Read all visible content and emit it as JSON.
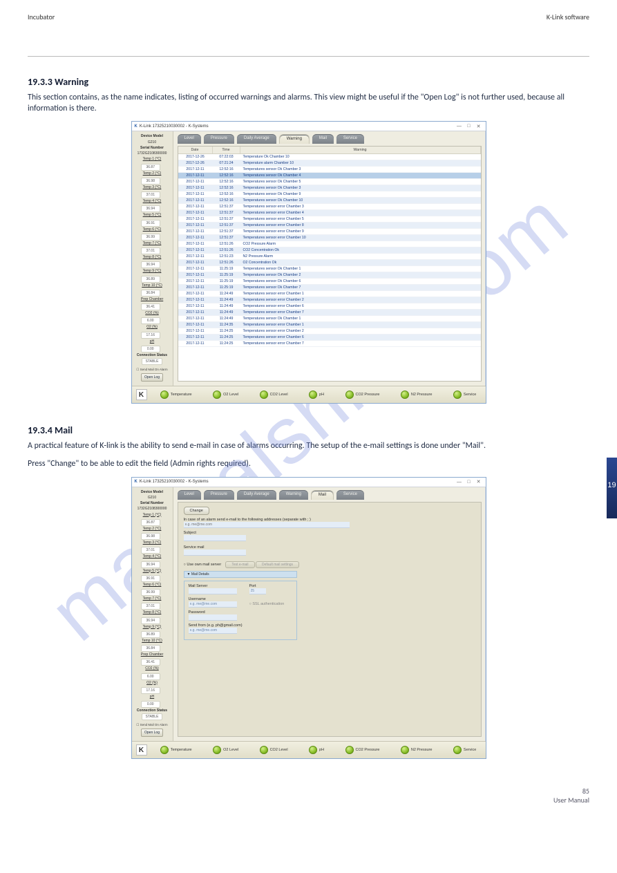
{
  "header": {
    "left": "Incubator",
    "right": "K-Link software"
  },
  "section1_title": "19.3.3 Warning",
  "section1_body": "This section contains, as the name indicates, listing of occurred warnings and alarms. This view might be useful if the \"Open Log\" is not further used, because all information is there.",
  "section2_title": "19.3.4 Mail",
  "section2_body_1": "A practical feature of K-link is the ability to send e-mail in case of alarms occurring. The setup of the e-mail settings is done under \"Mail\".",
  "section2_body_2": "Press \"Change\" to be able to edit the field (Admin rights required).",
  "watermark": "manualshive.com",
  "win1": {
    "title": "K-Link 17325210030002 - K-Systems",
    "tabs": [
      "Level",
      "Pressure",
      "Daily Average",
      "Warning",
      "Mail",
      "Service"
    ],
    "active_tab": 3,
    "grid": {
      "headers": [
        "Date",
        "Time",
        "Warning"
      ],
      "rows": [
        [
          "2017-12-26",
          "07:22:03",
          "Temperature Ok Chamber 10"
        ],
        [
          "2017-12-26",
          "07:21:24",
          "Temperature alarm Chamber 10"
        ],
        [
          "2017-12-11",
          "12:52:16",
          "Temperatures sensor Ok Chamber 3"
        ],
        [
          "2017-12-11",
          "12:52:16",
          "Temperatures sensor Ok Chamber 4"
        ],
        [
          "2017-12-11",
          "12:52:16",
          "Temperatures sensor Ok Chamber 5"
        ],
        [
          "2017-12-11",
          "12:52:16",
          "Temperatures sensor Ok Chamber 3"
        ],
        [
          "2017-12-11",
          "12:52:16",
          "Temperatures sensor Ok Chamber 9"
        ],
        [
          "2017-12-11",
          "12:52:16",
          "Temperatures sensor Ok Chamber 10"
        ],
        [
          "2017-12-11",
          "12:51:37",
          "Temperatures sensor error Chamber 3"
        ],
        [
          "2017-12-11",
          "12:51:37",
          "Temperatures sensor error Chamber 4"
        ],
        [
          "2017-12-11",
          "12:51:37",
          "Temperatures sensor error Chamber 5"
        ],
        [
          "2017-12-11",
          "12:51:37",
          "Temperatures sensor error Chamber 8"
        ],
        [
          "2017-12-11",
          "12:51:37",
          "Temperatures sensor error Chamber 9"
        ],
        [
          "2017-12-11",
          "12:51:37",
          "Temperatures sensor error Chamber 10"
        ],
        [
          "2017-12-11",
          "12:51:26",
          "CO2 Pressure Alarm"
        ],
        [
          "2017-12-11",
          "12:51:26",
          "CO2 Concentration Ok"
        ],
        [
          "2017-12-11",
          "12:51:23",
          "N2 Pressure Alarm"
        ],
        [
          "2017-12-11",
          "12:51:26",
          "O2 Concentration Ok"
        ],
        [
          "2017-12-11",
          "11:25:19",
          "Temperatures sensor Ok Chamber 1"
        ],
        [
          "2017-12-11",
          "11:25:19",
          "Temperatures sensor Ok Chamber 2"
        ],
        [
          "2017-12-11",
          "11:25:19",
          "Temperatures sensor Ok Chamber 6"
        ],
        [
          "2017-12-11",
          "11:25:19",
          "Temperatures sensor Ok Chamber 7"
        ],
        [
          "2017-12-11",
          "11:24:49",
          "Temperatures sensor error Chamber 1"
        ],
        [
          "2017-12-11",
          "11:24:49",
          "Temperatures sensor error Chamber 2"
        ],
        [
          "2017-12-11",
          "11:24:49",
          "Temperatures sensor error Chamber 6"
        ],
        [
          "2017-12-11",
          "11:24:49",
          "Temperatures sensor error Chamber 7"
        ],
        [
          "2017-12-11",
          "11:24:49",
          "Temperatures sensor Ok Chamber 1"
        ],
        [
          "2017-12-11",
          "11:24:35",
          "Temperatures sensor error Chamber 1"
        ],
        [
          "2017-12-11",
          "11:24:25",
          "Temperatures sensor error Chamber 2"
        ],
        [
          "2017-12-11",
          "11:24:25",
          "Temperatures sensor error Chamber 6"
        ],
        [
          "2017-12-11",
          "11:24:25",
          "Temperatures sensor error Chamber 7"
        ]
      ],
      "selected_row": 3
    }
  },
  "win2": {
    "title": "K-Link 17325210030002 - K-Systems",
    "tabs": [
      "Level",
      "Pressure",
      "Daily Average",
      "Warning",
      "Mail",
      "Service"
    ],
    "active_tab": 4,
    "mail": {
      "change_label": "Change",
      "intro": "In case of an alarm send e-mail to the following addresses (separate with ; )",
      "addresses_placeholder": "e.g. me@me.com",
      "subject_label": "Subject",
      "service_label": "Service mail",
      "use_own": "Use own mail server",
      "btn_test": "Test e-mail",
      "btn_default": "Default mail settings",
      "details_header": "▼ Mail Details",
      "mail_server_label": "Mail Server",
      "port_label": "Port",
      "port_value": "25",
      "username_label": "Username",
      "username_value": "e.g. me@me.com",
      "ssl_label": "SSL authentication",
      "password_label": "Password",
      "sendfrom_label": "Send from (e.g. ph@gmail.com)",
      "sendfrom_value": "e.g. me@me.com"
    }
  },
  "sidebar": {
    "model_label": "Device Model",
    "model_value": "G210",
    "serial_label": "Serial Number",
    "serial_value": "1732G2108300000",
    "metrics": [
      {
        "label": "Temp 1 (°C)",
        "value": "36.87"
      },
      {
        "label": "Temp 2 (°C)",
        "value": "36.98"
      },
      {
        "label": "Temp 3 (°C)",
        "value": "37.01"
      },
      {
        "label": "Temp 4 (°C)",
        "value": "36.94"
      },
      {
        "label": "Temp 5 (°C)",
        "value": "36.91"
      },
      {
        "label": "Temp 6 (°C)",
        "value": "36.99"
      },
      {
        "label": "Temp 7 (°C)",
        "value": "37.01"
      },
      {
        "label": "Temp 8 (°C)",
        "value": "36.94"
      },
      {
        "label": "Temp 9 (°C)",
        "value": "36.89"
      },
      {
        "label": "Temp 10 (°C)",
        "value": "36.84"
      },
      {
        "label": "Prep Chamber",
        "value": "36.41"
      },
      {
        "label": "CO2 (%)",
        "value": "6.00"
      },
      {
        "label": "O2 (%)",
        "value": "17.16"
      },
      {
        "label": "pH",
        "value": "0.00"
      }
    ],
    "conn_label": "Connection Status",
    "conn_value": "STABLE",
    "check_label": "Send Mail On Alarm",
    "openlog_label": "Open Log"
  },
  "status_items": [
    "Temperature",
    "O2 Level",
    "CO2 Level",
    "pH",
    "CO2 Pressure",
    "N2 Pressure",
    "Service"
  ],
  "righttab_label": "19",
  "footer": {
    "page": "85",
    "doc": "User Manual"
  }
}
